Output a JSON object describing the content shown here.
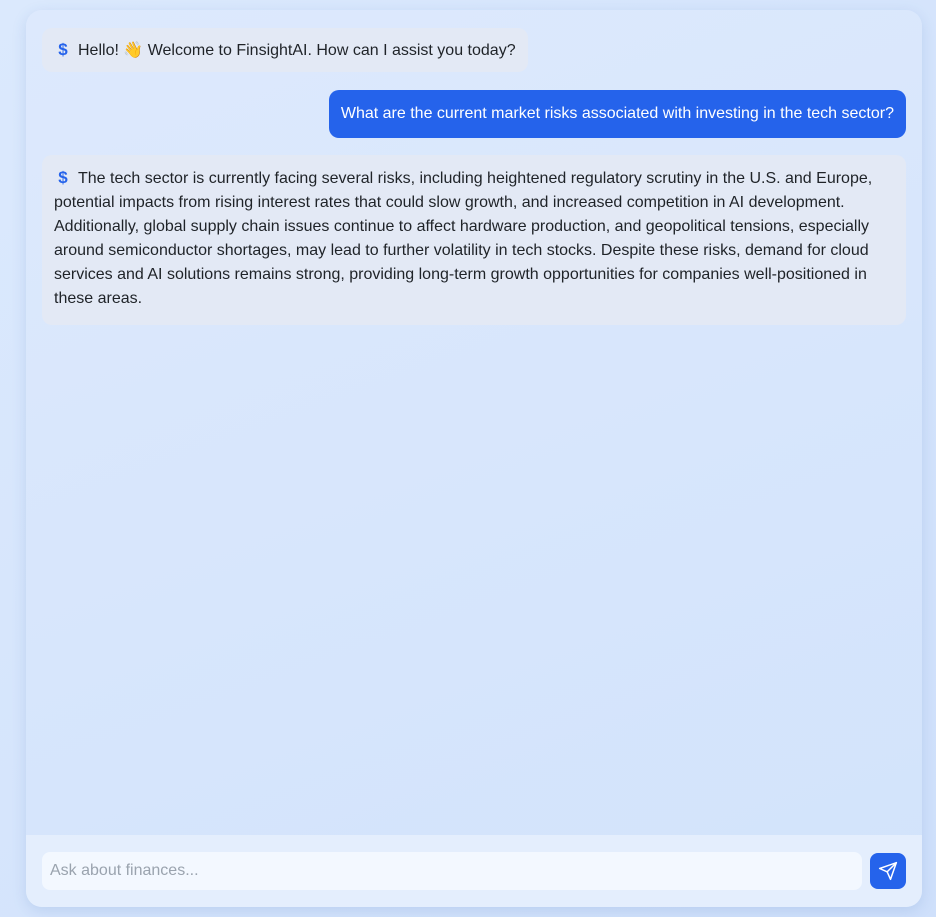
{
  "messages": {
    "greeting": {
      "icon": "dollar-icon",
      "icon_glyph": "$",
      "text": "Hello! 👋 Welcome to FinsightAI. How can I assist you today?"
    },
    "user_question": {
      "text": "What are the current market risks associated with investing in the tech sector?"
    },
    "answer": {
      "icon": "dollar-icon",
      "icon_glyph": "$",
      "text": "The tech sector is currently facing several risks, including heightened regulatory scrutiny in the U.S. and Europe, potential impacts from rising interest rates that could slow growth, and increased competition in AI development. Additionally, global supply chain issues continue to affect hardware production, and geopolitical tensions, especially around semiconductor shortages, may lead to further volatility in tech stocks. Despite these risks, demand for cloud services and AI solutions remains strong, providing long-term growth opportunities for companies well-positioned in these areas."
    }
  },
  "input": {
    "value": "",
    "placeholder": "Ask about finances..."
  },
  "send_button": {
    "icon": "send-icon"
  },
  "colors": {
    "accent": "#2563eb",
    "bot_bubble": "#e3e9f5",
    "user_text": "#ffffff"
  }
}
